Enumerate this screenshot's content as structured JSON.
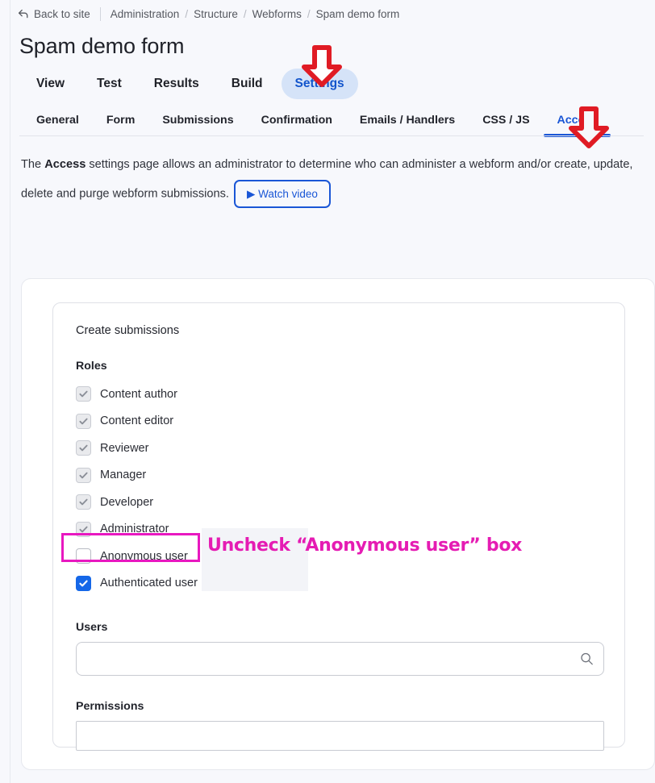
{
  "breadcrumb": {
    "back_label": "Back to site",
    "back_icon": "back-arrow-icon",
    "items": [
      "Administration",
      "Structure",
      "Webforms",
      "Spam demo form"
    ],
    "separator": "/"
  },
  "header": {
    "title": "Spam demo form"
  },
  "primary_tabs": [
    {
      "label": "View",
      "active": false
    },
    {
      "label": "Test",
      "active": false
    },
    {
      "label": "Results",
      "active": false
    },
    {
      "label": "Build",
      "active": false
    },
    {
      "label": "Settings",
      "active": true
    }
  ],
  "secondary_tabs": [
    {
      "label": "General",
      "active": false
    },
    {
      "label": "Form",
      "active": false
    },
    {
      "label": "Submissions",
      "active": false
    },
    {
      "label": "Confirmation",
      "active": false
    },
    {
      "label": "Emails / Handlers",
      "active": false
    },
    {
      "label": "CSS / JS",
      "active": false
    },
    {
      "label": "Access",
      "active": true
    }
  ],
  "description": {
    "part1": "The ",
    "strong": "Access",
    "part2": " settings page allows an administrator to determine who can administer a webform and/or create, update, delete and purge webform submissions.",
    "watch_video_label": "▶ Watch video"
  },
  "access_section": {
    "section_title": "Create submissions",
    "roles_label": "Roles",
    "roles": [
      {
        "label": "Content author",
        "state": "disabled-checked"
      },
      {
        "label": "Content editor",
        "state": "disabled-checked"
      },
      {
        "label": "Reviewer",
        "state": "disabled-checked"
      },
      {
        "label": "Manager",
        "state": "disabled-checked"
      },
      {
        "label": "Developer",
        "state": "disabled-checked"
      },
      {
        "label": "Administrator",
        "state": "disabled-checked"
      },
      {
        "label": "Anonymous user",
        "state": "empty"
      },
      {
        "label": "Authenticated user",
        "state": "checked"
      }
    ],
    "users_label": "Users",
    "users_value": "",
    "users_placeholder": "",
    "users_icon": "search-icon",
    "permissions_label": "Permissions",
    "permissions_value": "",
    "permissions_placeholder": ""
  },
  "annotations": {
    "arrow_settings": "down-arrow-icon",
    "arrow_access": "down-arrow-icon",
    "highlight_box_target": "Anonymous user",
    "callout_text": "Uncheck “Anonymous user” box"
  },
  "colors": {
    "page_background": "#f7f8fc",
    "card_background": "#ffffff",
    "accent_blue": "#1a56d6",
    "active_pill": "#d5e3f8",
    "checked_checkbox": "#1567e8",
    "annotation_magenta": "#e51cb3",
    "annotation_red": "#e01b24"
  }
}
